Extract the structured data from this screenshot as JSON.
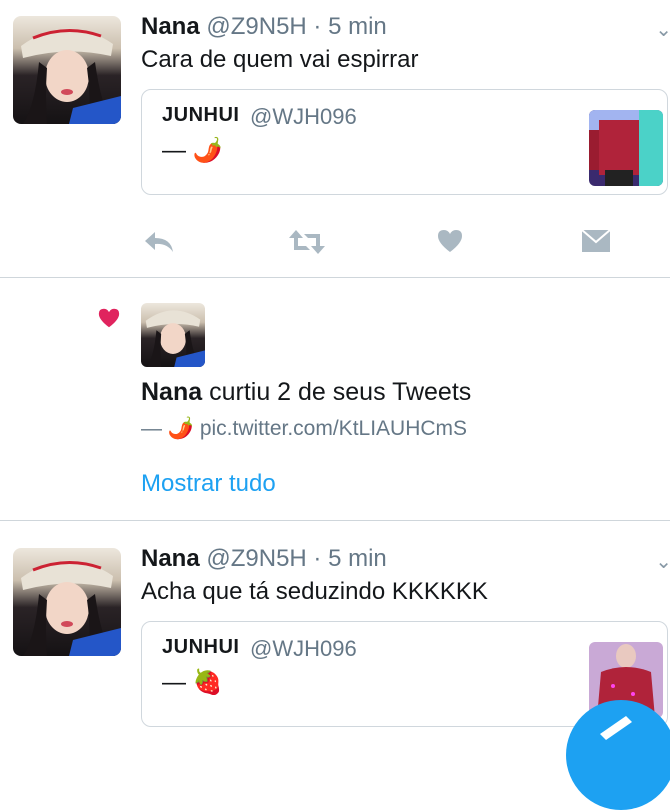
{
  "tweet1": {
    "name": "Nana",
    "handle": "@Z9N5H",
    "time": "· 5 min",
    "text": "Cara de quem vai espirrar",
    "quote": {
      "name": "JUNHUI",
      "handle": "@WJH096",
      "text": "— 🌶️"
    }
  },
  "notification": {
    "name": "Nana",
    "action": " curtiu 2 de seus Tweets",
    "link": "— 🌶️ pic.twitter.com/KtLIAUHCmS",
    "show_all": "Mostrar tudo"
  },
  "tweet2": {
    "name": "Nana",
    "handle": "@Z9N5H",
    "time": "· 5 min",
    "text": "Acha que tá seduzindo KKKKKK",
    "quote": {
      "name": "JUNHUI",
      "handle": "@WJH096",
      "text": "— 🍓"
    }
  },
  "colors": {
    "accent": "#1da1f2",
    "like": "#e0245e",
    "icon_gray": "#aab8c2"
  },
  "icons": [
    "reply-icon",
    "retweet-icon",
    "like-icon",
    "dm-icon",
    "heart-icon",
    "chevron-down-icon",
    "compose-icon"
  ]
}
